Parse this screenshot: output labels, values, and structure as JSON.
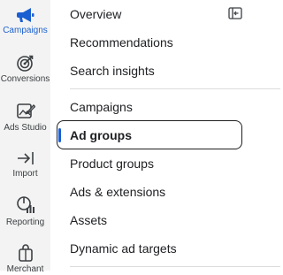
{
  "rail": {
    "items": [
      {
        "label": "Campaigns",
        "icon": "megaphone-icon",
        "active": true
      },
      {
        "label": "Conversions",
        "icon": "target-icon",
        "active": false
      },
      {
        "label": "Ads Studio",
        "icon": "ads-studio-icon",
        "active": false
      },
      {
        "label": "Import",
        "icon": "import-icon",
        "active": false
      },
      {
        "label": "Reporting",
        "icon": "reporting-icon",
        "active": false
      },
      {
        "label": "Merchant",
        "icon": "shopping-bag-icon",
        "active": false
      }
    ],
    "active_color": "#1a5fd1"
  },
  "menu": {
    "items": [
      {
        "label": "Overview"
      },
      {
        "label": "Recommendations"
      },
      {
        "label": "Search insights"
      },
      {
        "label": "Campaigns"
      },
      {
        "label": "Ad groups",
        "selected": true
      },
      {
        "label": "Product groups"
      },
      {
        "label": "Ads & extensions"
      },
      {
        "label": "Assets"
      },
      {
        "label": "Dynamic ad targets"
      }
    ],
    "collapse_icon": "collapse-panel-icon"
  }
}
